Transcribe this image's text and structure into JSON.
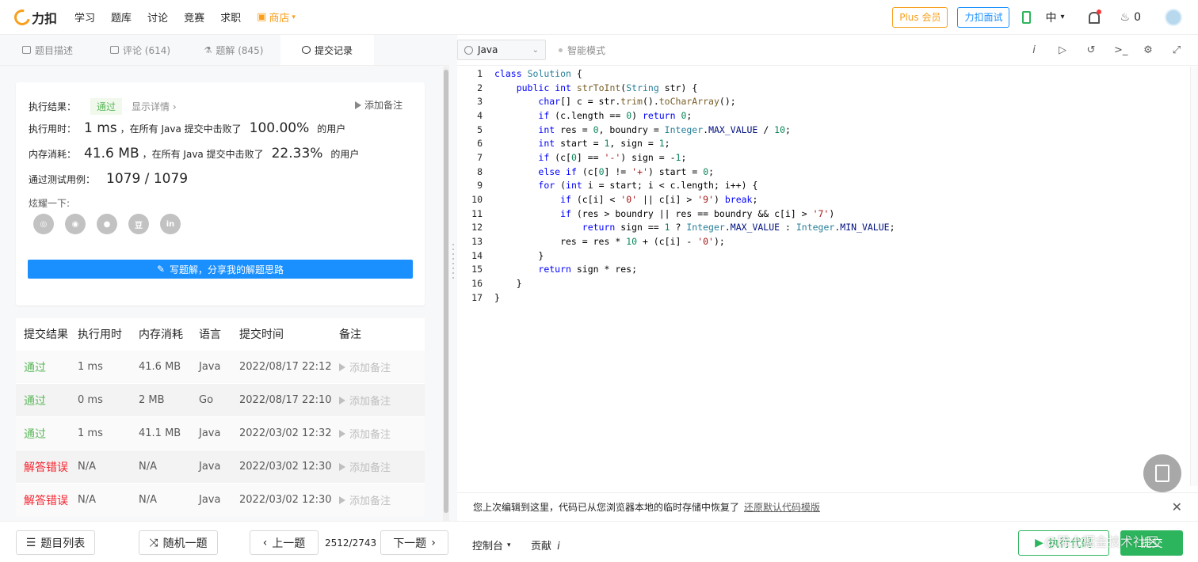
{
  "topnav": {
    "logo_text": "力扣",
    "links": [
      "学习",
      "题库",
      "讨论",
      "竞赛",
      "求职"
    ],
    "shop": "商店",
    "plus_button": "Plus 会员",
    "interview_button": "力扣面试",
    "language": "中",
    "flame_count": "0"
  },
  "tabs": [
    {
      "label": "题目描述"
    },
    {
      "label": "评论 (614)"
    },
    {
      "label": "题解 (845)"
    },
    {
      "label": "提交记录"
    }
  ],
  "result": {
    "exec_result_label": "执行结果：",
    "status": "通过",
    "detail_link": "显示详情 ›",
    "add_note": "添加备注",
    "runtime_label": "执行用时：",
    "runtime_value": "1 ms",
    "runtime_text": "，在所有 Java 提交中击败了",
    "runtime_percent": "100.00%",
    "runtime_suffix": "的用户",
    "memory_label": "内存消耗：",
    "memory_value": "41.6 MB",
    "memory_text": "，在所有 Java 提交中击败了",
    "memory_percent": "22.33%",
    "memory_suffix": "的用户",
    "tests_label": "通过测试用例：",
    "tests_value": "1079 / 1079",
    "share_label": "炫耀一下:",
    "social_icons": [
      "wechat-icon",
      "weibo-icon",
      "qq-icon",
      "douban-icon",
      "linkedin-icon"
    ],
    "write_button": "写题解，分享我的解题思路"
  },
  "submissions": {
    "headers": [
      "提交结果",
      "执行用时",
      "内存消耗",
      "语言",
      "提交时间",
      "备注"
    ],
    "rows": [
      {
        "status": "通过",
        "ok": true,
        "time": "1 ms",
        "mem": "41.6 MB",
        "lang": "Java",
        "date": "2022/08/17 22:12",
        "note": "添加备注"
      },
      {
        "status": "通过",
        "ok": true,
        "time": "0 ms",
        "mem": "2 MB",
        "lang": "Go",
        "date": "2022/08/17 22:10",
        "note": "添加备注"
      },
      {
        "status": "通过",
        "ok": true,
        "time": "1 ms",
        "mem": "41.1 MB",
        "lang": "Java",
        "date": "2022/03/02 12:32",
        "note": "添加备注"
      },
      {
        "status": "解答错误",
        "ok": false,
        "time": "N/A",
        "mem": "N/A",
        "lang": "Java",
        "date": "2022/03/02 12:30",
        "note": "添加备注"
      },
      {
        "status": "解答错误",
        "ok": false,
        "time": "N/A",
        "mem": "N/A",
        "lang": "Java",
        "date": "2022/03/02 12:30",
        "note": "添加备注"
      }
    ]
  },
  "editor": {
    "language": "Java",
    "smart_mode": "智能模式",
    "notice": "您上次编辑到这里，代码已从您浏览器本地的临时存储中恢复了",
    "notice_link": "还原默认代码模版",
    "code_lines": [
      "class Solution {",
      "    public int strToInt(String str) {",
      "        char[] c = str.trim().toCharArray();",
      "        if (c.length == 0) return 0;",
      "        int res = 0, boundry = Integer.MAX_VALUE / 10;",
      "        int start = 1, sign = 1;",
      "        if (c[0] == '-') sign = -1;",
      "        else if (c[0] != '+') start = 0;",
      "        for (int i = start; i < c.length; i++) {",
      "            if (c[i] < '0' || c[i] > '9') break;",
      "            if (res > boundry || res == boundry && c[i] > '7')",
      "                return sign == 1 ? Integer.MAX_VALUE : Integer.MIN_VALUE;",
      "            res = res * 10 + (c[i] - '0');",
      "        }",
      "        return sign * res;",
      "    }",
      "}"
    ]
  },
  "bottombar": {
    "problem_list": "题目列表",
    "random": "随机一题",
    "prev": "上一题",
    "pager": "2512/2743",
    "next": "下一题",
    "console": "控制台",
    "contribute": "贡献",
    "run": "执行代码",
    "submit": "提交",
    "watermark": "@稀土掘金技术社区"
  },
  "colors": {
    "brand": "#f89f1b",
    "primary": "#1a90ff",
    "success": "#2db55d",
    "error": "#f5222d"
  }
}
